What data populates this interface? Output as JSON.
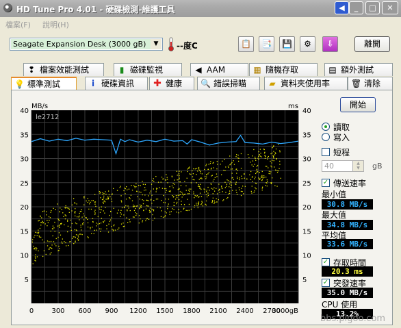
{
  "window": {
    "title": "HD Tune Pro 4.01 - 硬碟檢測-維護工具",
    "buttons": {
      "back": "◀",
      "minimize": "_",
      "maximize": "□",
      "close": "✕"
    }
  },
  "menu": {
    "items": [
      "檔案(F)",
      "說明(H)"
    ]
  },
  "toolbar": {
    "drive": "Seagate Expansion Desk   (3000 gB)",
    "temperature": "--度C",
    "exit_label": "離開",
    "icons": [
      "copy-text-icon",
      "copy-screen-icon",
      "save-icon",
      "options-icon",
      "download-icon"
    ]
  },
  "tabs": {
    "row1": [
      {
        "label": "檔案效能測試",
        "icon": "file-benchmark-icon"
      },
      {
        "label": "磁碟監視",
        "icon": "disk-monitor-icon"
      },
      {
        "label": "AAM",
        "icon": "aam-speaker-icon"
      },
      {
        "label": "隨機存取",
        "icon": "random-access-icon"
      },
      {
        "label": "額外測試",
        "icon": "extra-tests-icon"
      }
    ],
    "row2": [
      {
        "label": "標準測試",
        "icon": "benchmark-bulb-icon"
      },
      {
        "label": "硬碟資訊",
        "icon": "info-icon"
      },
      {
        "label": "健康",
        "icon": "health-cross-icon"
      },
      {
        "label": "錯誤掃瞄",
        "icon": "error-scan-icon"
      },
      {
        "label": "資料夾使用率",
        "icon": "folder-usage-icon"
      },
      {
        "label": "清除",
        "icon": "erase-trash-icon"
      }
    ],
    "active": "標準測試"
  },
  "side": {
    "start_label": "開始",
    "read_label": "讀取",
    "write_label": "寫入",
    "short_label": "短程",
    "short_value": "40",
    "short_unit": "gB",
    "transfer_label": "傳送速率",
    "min_label": "最小值",
    "min_value": "30.8 MB/s",
    "max_label": "最大值",
    "max_value": "34.8 MB/s",
    "avg_label": "平均值",
    "avg_value": "33.6 MB/s",
    "access_label": "存取時間",
    "access_value": "20.3 ms",
    "burst_label": "突發速率",
    "burst_value": "35.0 MB/s",
    "cpu_label": "CPU 使用",
    "cpu_value": "13.2%"
  },
  "watermark": "bbs.pigoo.com",
  "chart_data": {
    "type": "line",
    "title": "",
    "watermark_label": "le2712",
    "ylabel_left": "MB/s",
    "ylabel_right": "ms",
    "xlabel": "",
    "x_unit_suffix": "gB",
    "xlim": [
      0,
      3000
    ],
    "ylim_left": [
      0,
      40
    ],
    "ylim_right": [
      0,
      40
    ],
    "x_ticks": [
      0,
      300,
      600,
      900,
      1200,
      1500,
      1800,
      2100,
      2400,
      2700,
      3000
    ],
    "y_ticks_left": [
      5,
      10,
      15,
      20,
      25,
      30,
      35,
      40
    ],
    "y_ticks_right": [
      5,
      10,
      15,
      20,
      25,
      30,
      35,
      40
    ],
    "grid": true,
    "background": "#000000",
    "colors": {
      "transfer": "#2ea8ff",
      "access": "#e6e600",
      "grid": "#3a3a3a"
    },
    "series": [
      {
        "kind": "line",
        "x": [
          0,
          100,
          200,
          300,
          400,
          500,
          600,
          700,
          800,
          900,
          950,
          1000,
          1050,
          1100,
          1200,
          1300,
          1400,
          1500,
          1600,
          1700,
          1750,
          1800,
          1900,
          2000,
          2100,
          2200,
          2300,
          2350,
          2400,
          2500,
          2600,
          2700,
          2800,
          2900,
          3000
        ],
        "values": [
          33.5,
          34.1,
          33.6,
          34.0,
          33.7,
          34.2,
          33.8,
          34.0,
          33.9,
          33.8,
          31.0,
          34.0,
          33.5,
          33.9,
          33.4,
          33.8,
          33.5,
          34.0,
          33.6,
          33.7,
          33.0,
          33.9,
          33.4,
          32.8,
          33.2,
          33.4,
          33.5,
          34.8,
          33.3,
          33.2,
          33.0,
          33.4,
          33.1,
          33.3,
          33.6
        ]
      },
      {
        "kind": "scatter-band",
        "x": [
          0,
          300,
          600,
          900,
          1200,
          1500,
          1800,
          2100,
          2400,
          2700
        ],
        "values": [
          13,
          16,
          18,
          19.5,
          21,
          22.5,
          24,
          25.5,
          27,
          28.5
        ],
        "spread": [
          5,
          5,
          4.5,
          4.5,
          4.5,
          4.5,
          4.5,
          4.5,
          4.5,
          4.5
        ]
      }
    ]
  }
}
